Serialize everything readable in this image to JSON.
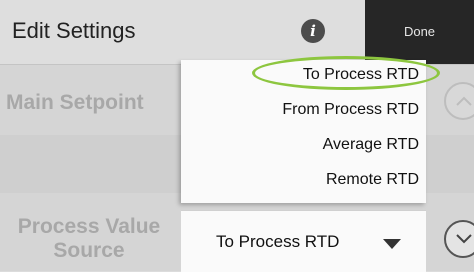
{
  "header": {
    "title": "Edit Settings",
    "info_icon": "info-icon",
    "done_label": "Done"
  },
  "rows": {
    "main_setpoint_label": "Main Setpoint",
    "process_value_source_label_line1": "Process Value",
    "process_value_source_label_line2": "Source"
  },
  "dropdown": {
    "options": [
      "To Process RTD",
      "From Process RTD",
      "Average RTD",
      "Remote RTD"
    ],
    "highlighted_option": "To Process RTD",
    "highlight_color": "#8dc63f"
  },
  "select": {
    "value": "To Process RTD",
    "caret_icon": "caret-down-icon"
  },
  "buttons": {
    "up_icon": "chevron-up-icon",
    "down_icon": "chevron-down-icon"
  },
  "colors": {
    "header_bg": "#dedede",
    "done_bg": "#262626",
    "panel_bg": "#d5d5d5",
    "label_color": "#a8a8a8"
  }
}
